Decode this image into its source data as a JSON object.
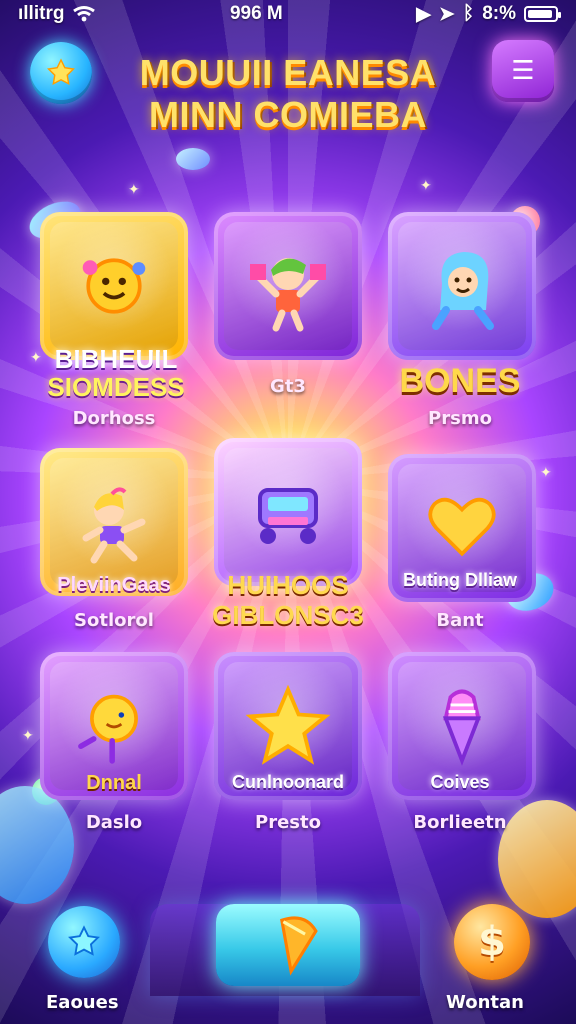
{
  "status_bar": {
    "left_text": "ıllitrg",
    "time": "996 M",
    "battery": "8:%"
  },
  "title": {
    "line1": "MOUUII EANESA",
    "line2": "MINN COMIEBA"
  },
  "top_buttons": {
    "left_icon": "star-icon",
    "right_icon": "menu-icon"
  },
  "tiles": [
    {
      "main_label_line1": "BIBHEUIL",
      "main_label_line2": "SIOMDESS",
      "sub_label": "Dorhoss",
      "icon": "sun-face-icon"
    },
    {
      "main_label_line1": "",
      "main_label_line2": "",
      "sub_label": "Gt3",
      "icon": "jumping-kid-icon"
    },
    {
      "main_label_line1": "BONES",
      "main_label_line2": "",
      "sub_label": "Prsmo",
      "icon": "hooded-kid-icon"
    },
    {
      "main_label_line1": "PleviinGaas",
      "main_label_line2": "",
      "sub_label": "Sotlorol",
      "icon": "running-kid-icon"
    },
    {
      "main_label_line1": "HUIHOOS",
      "main_label_line2": "GIBLONSC3",
      "sub_label": "",
      "icon": "arcade-machine-icon"
    },
    {
      "main_label_line1": "Buting Dlliaw",
      "main_label_line2": "",
      "sub_label": "Bant",
      "icon": "heart-icon"
    },
    {
      "main_label_line1": "Dnnal",
      "main_label_line2": "",
      "sub_label": "Daslo",
      "icon": "smiley-balloon-icon"
    },
    {
      "main_label_line1": "Cunlnoonard",
      "main_label_line2": "",
      "sub_label": "Presto",
      "icon": "star-icon"
    },
    {
      "main_label_line1": "Coives",
      "main_label_line2": "",
      "sub_label": "Borlieetn",
      "icon": "ice-cream-icon"
    }
  ],
  "bottom_nav": {
    "left_label": "Eaoues",
    "right_label": "Wontan",
    "center_icon": "cone-icon",
    "right_icon": "dollar-icon",
    "left_icon": "star-icon"
  }
}
